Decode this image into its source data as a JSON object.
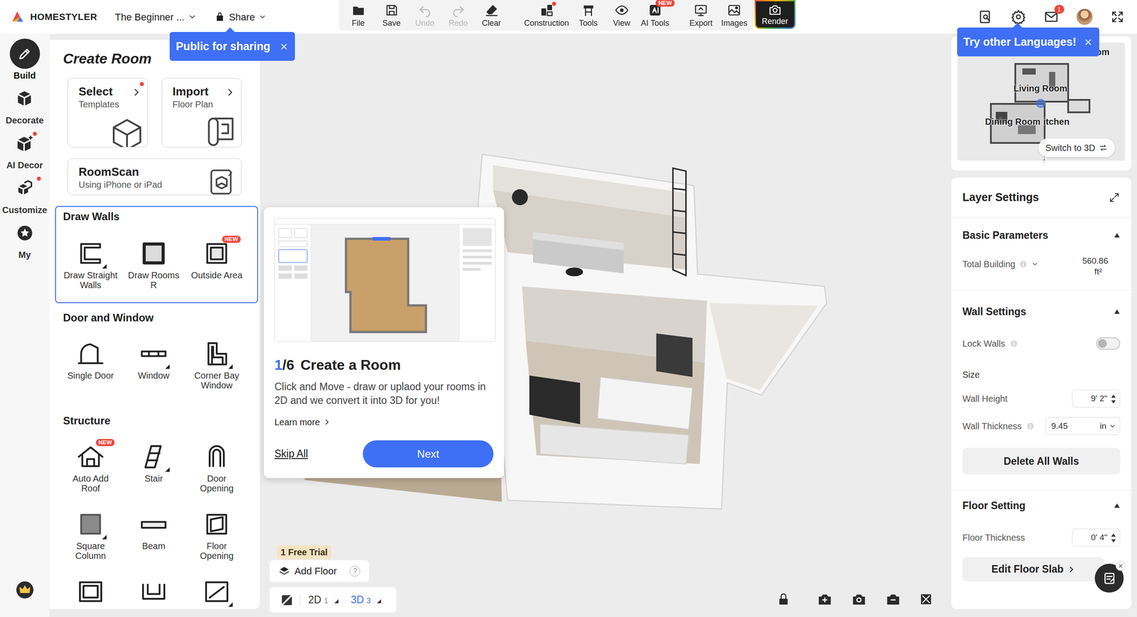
{
  "header": {
    "logo": "HOMESTYLER",
    "project": "The Beginner ...",
    "share": "Share",
    "mail_badge": "1"
  },
  "toolbar": [
    {
      "label": "File",
      "disabled": false,
      "kind": "tool"
    },
    {
      "label": "Save",
      "disabled": false,
      "kind": "tool"
    },
    {
      "label": "Undo",
      "disabled": true,
      "kind": "tool"
    },
    {
      "label": "Redo",
      "disabled": true,
      "kind": "tool"
    },
    {
      "label": "Clear",
      "disabled": false,
      "kind": "tool"
    },
    {
      "label": "Construction",
      "disabled": false,
      "dot": true,
      "kind": "tool"
    },
    {
      "label": "Tools",
      "disabled": false,
      "kind": "tool"
    },
    {
      "label": "View",
      "disabled": false,
      "kind": "tool"
    },
    {
      "label": "AI Tools",
      "disabled": false,
      "badge": "NEW",
      "kind": "tool"
    },
    {
      "label": "Export",
      "disabled": false,
      "kind": "tool"
    },
    {
      "label": "Images",
      "disabled": false,
      "kind": "tool"
    },
    {
      "label": "Render",
      "disabled": false,
      "kind": "render"
    }
  ],
  "share_tooltip": {
    "text": "Public for sharing",
    "close": "×"
  },
  "language_tooltip": {
    "text": "Try other Languages!",
    "close": "×"
  },
  "rail": [
    {
      "label": "Build",
      "selected": true,
      "dot": false
    },
    {
      "label": "Decorate",
      "selected": false,
      "dot": false
    },
    {
      "label": "AI Decor",
      "selected": false,
      "dot": true
    },
    {
      "label": "Customize",
      "selected": false,
      "dot": true
    },
    {
      "label": "My",
      "selected": false,
      "dot": false
    }
  ],
  "panel": {
    "title": "Create Room",
    "cards": [
      {
        "title": "Select",
        "subtitle": "Templates",
        "dot": true
      },
      {
        "title": "Import",
        "subtitle": "Floor Plan",
        "dot": false
      },
      {
        "title": "RoomScan",
        "subtitle": "Using iPhone or iPad",
        "dot": false
      }
    ],
    "sections": [
      {
        "title": "Draw Walls",
        "highlighted": true,
        "items": [
          {
            "label": "Draw Straight Walls",
            "submenu": true
          },
          {
            "label": "Draw Rooms",
            "shortcut": "R",
            "submenu": false
          },
          {
            "label": "Outside Area",
            "badge": "NEW",
            "submenu": false
          }
        ]
      },
      {
        "title": "Door and Window",
        "highlighted": false,
        "items": [
          {
            "label": "Single Door",
            "submenu": false
          },
          {
            "label": "Window",
            "submenu": true
          },
          {
            "label": "Corner Bay Window",
            "submenu": true
          }
        ]
      },
      {
        "title": "Structure",
        "highlighted": false,
        "items": [
          {
            "label": "Auto Add Roof",
            "badge": "NEW",
            "submenu": false
          },
          {
            "label": "Stair",
            "submenu": true
          },
          {
            "label": "Door Opening",
            "submenu": false
          },
          {
            "label": "Square Column",
            "submenu": true
          },
          {
            "label": "Beam",
            "submenu": false
          },
          {
            "label": "Floor Opening",
            "submenu": false
          },
          {
            "submenu": false
          },
          {
            "submenu": false
          },
          {
            "submenu": true
          }
        ]
      }
    ]
  },
  "popover": {
    "step": "1",
    "total": "/6",
    "title": "Create a Room",
    "description": "Click and Move - draw or uplaod your rooms in 2D and we convert it into 3D for you!",
    "learn_more": "Learn more",
    "skip": "Skip All",
    "next": "Next"
  },
  "minimap": {
    "labels": [
      "om",
      "Living Room",
      "Dining Room",
      "itchen"
    ],
    "switch": "Switch to 3D"
  },
  "layer": {
    "title": "Layer Settings",
    "basic": {
      "title": "Basic Parameters",
      "expanded": true,
      "total_label": "Total Building",
      "total_value": "560.86",
      "total_unit": "ft²"
    },
    "wall": {
      "title": "Wall Settings",
      "expanded": true,
      "lock_label": "Lock Walls",
      "lock_on": false,
      "size_label": "Size",
      "height_label": "Wall Height",
      "height_value": "9' 2\"",
      "thickness_label": "Wall Thickness",
      "thickness_value": "9.45",
      "thickness_unit": "in",
      "delete_button": "Delete All Walls"
    },
    "floor": {
      "title": "Floor Setting",
      "expanded": true,
      "thickness_label": "Floor Thickness",
      "thickness_value": "0' 4\"",
      "edit_button": "Edit Floor Slab"
    }
  },
  "bottom": {
    "trial": "1 Free Trial",
    "add_floor": "Add Floor",
    "help": "?",
    "chat_close": "×",
    "views": [
      {
        "label": "2D",
        "count": "1",
        "selected": false
      },
      {
        "label": "3D",
        "count": "3",
        "selected": true
      }
    ]
  }
}
